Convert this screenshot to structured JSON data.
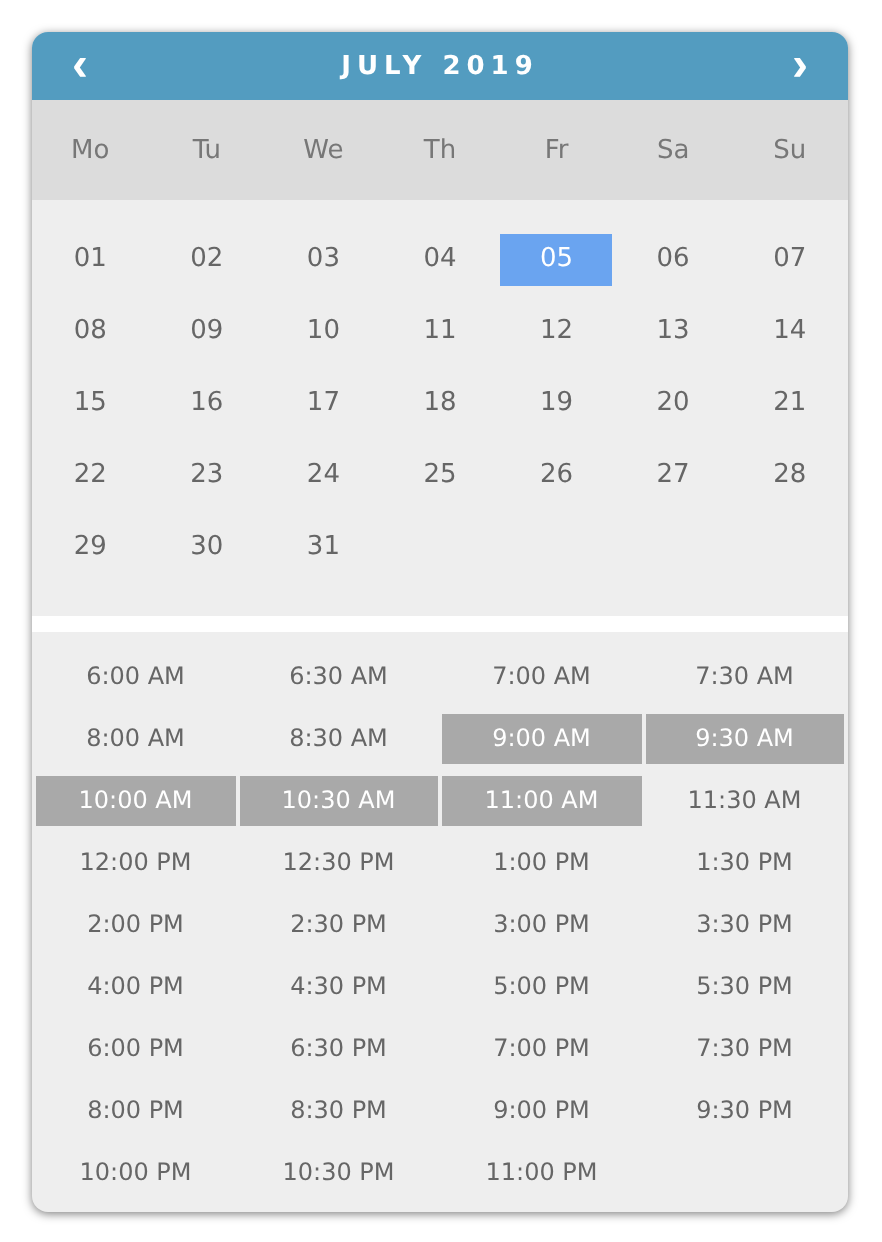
{
  "header": {
    "prev": "‹",
    "title": "JULY 2019",
    "next": "›"
  },
  "weekdays": [
    "Mo",
    "Tu",
    "We",
    "Th",
    "Fr",
    "Sa",
    "Su"
  ],
  "days": [
    {
      "label": "01",
      "selected": false
    },
    {
      "label": "02",
      "selected": false
    },
    {
      "label": "03",
      "selected": false
    },
    {
      "label": "04",
      "selected": false
    },
    {
      "label": "05",
      "selected": true
    },
    {
      "label": "06",
      "selected": false
    },
    {
      "label": "07",
      "selected": false
    },
    {
      "label": "08",
      "selected": false
    },
    {
      "label": "09",
      "selected": false
    },
    {
      "label": "10",
      "selected": false
    },
    {
      "label": "11",
      "selected": false
    },
    {
      "label": "12",
      "selected": false
    },
    {
      "label": "13",
      "selected": false
    },
    {
      "label": "14",
      "selected": false
    },
    {
      "label": "15",
      "selected": false
    },
    {
      "label": "16",
      "selected": false
    },
    {
      "label": "17",
      "selected": false
    },
    {
      "label": "18",
      "selected": false
    },
    {
      "label": "19",
      "selected": false
    },
    {
      "label": "20",
      "selected": false
    },
    {
      "label": "21",
      "selected": false
    },
    {
      "label": "22",
      "selected": false
    },
    {
      "label": "23",
      "selected": false
    },
    {
      "label": "24",
      "selected": false
    },
    {
      "label": "25",
      "selected": false
    },
    {
      "label": "26",
      "selected": false
    },
    {
      "label": "27",
      "selected": false
    },
    {
      "label": "28",
      "selected": false
    },
    {
      "label": "29",
      "selected": false
    },
    {
      "label": "30",
      "selected": false
    },
    {
      "label": "31",
      "selected": false
    }
  ],
  "times": [
    {
      "label": "6:00 AM",
      "disabled": false
    },
    {
      "label": "6:30 AM",
      "disabled": false
    },
    {
      "label": "7:00 AM",
      "disabled": false
    },
    {
      "label": "7:30 AM",
      "disabled": false
    },
    {
      "label": "8:00 AM",
      "disabled": false
    },
    {
      "label": "8:30 AM",
      "disabled": false
    },
    {
      "label": "9:00 AM",
      "disabled": true
    },
    {
      "label": "9:30 AM",
      "disabled": true
    },
    {
      "label": "10:00 AM",
      "disabled": true
    },
    {
      "label": "10:30 AM",
      "disabled": true
    },
    {
      "label": "11:00 AM",
      "disabled": true
    },
    {
      "label": "11:30 AM",
      "disabled": false
    },
    {
      "label": "12:00 PM",
      "disabled": false
    },
    {
      "label": "12:30 PM",
      "disabled": false
    },
    {
      "label": "1:00 PM",
      "disabled": false
    },
    {
      "label": "1:30 PM",
      "disabled": false
    },
    {
      "label": "2:00 PM",
      "disabled": false
    },
    {
      "label": "2:30 PM",
      "disabled": false
    },
    {
      "label": "3:00 PM",
      "disabled": false
    },
    {
      "label": "3:30 PM",
      "disabled": false
    },
    {
      "label": "4:00 PM",
      "disabled": false
    },
    {
      "label": "4:30 PM",
      "disabled": false
    },
    {
      "label": "5:00 PM",
      "disabled": false
    },
    {
      "label": "5:30 PM",
      "disabled": false
    },
    {
      "label": "6:00 PM",
      "disabled": false
    },
    {
      "label": "6:30 PM",
      "disabled": false
    },
    {
      "label": "7:00 PM",
      "disabled": false
    },
    {
      "label": "7:30 PM",
      "disabled": false
    },
    {
      "label": "8:00 PM",
      "disabled": false
    },
    {
      "label": "8:30 PM",
      "disabled": false
    },
    {
      "label": "9:00 PM",
      "disabled": false
    },
    {
      "label": "9:30 PM",
      "disabled": false
    },
    {
      "label": "10:00 PM",
      "disabled": false
    },
    {
      "label": "10:30 PM",
      "disabled": false
    },
    {
      "label": "11:00 PM",
      "disabled": false
    }
  ]
}
